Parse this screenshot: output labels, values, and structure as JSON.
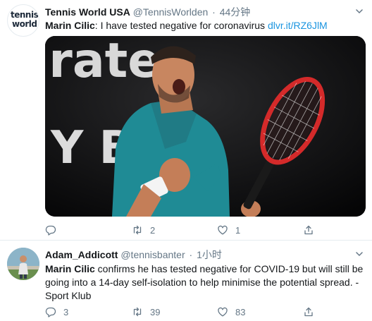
{
  "tweets": [
    {
      "author_name": "Tennis World USA",
      "handle": "@TennisWorlden",
      "separator": "·",
      "time": "44分钟",
      "avatar_text_1": "tennis",
      "avatar_text_2": "world",
      "text_bold": "Marin Cilic",
      "text_rest": ": I have tested negative for coronavirus ",
      "link": "dlvr.it/RZ6JlM",
      "replies": "",
      "retweets": "2",
      "likes": "1",
      "media_sign_text_1": "irates",
      "media_sign_text_2": "Y BE"
    },
    {
      "author_name": "Adam_Addicott",
      "handle": "@tennisbanter",
      "separator": "·",
      "time": "1小时",
      "text_bold": "Marin Cilic",
      "text_rest": " confirms he has tested negative for COVID-19 but will still be going into a 14-day self-isolation to help minimise the potential spread. - Sport Klub",
      "replies": "3",
      "retweets": "39",
      "likes": "83"
    }
  ],
  "colors": {
    "link": "#1b95e0",
    "muted": "#657786",
    "text": "#14171a",
    "divider": "#e6ecf0"
  },
  "icons": [
    "chevron-down-icon",
    "reply-icon",
    "retweet-icon",
    "like-icon",
    "share-icon"
  ]
}
